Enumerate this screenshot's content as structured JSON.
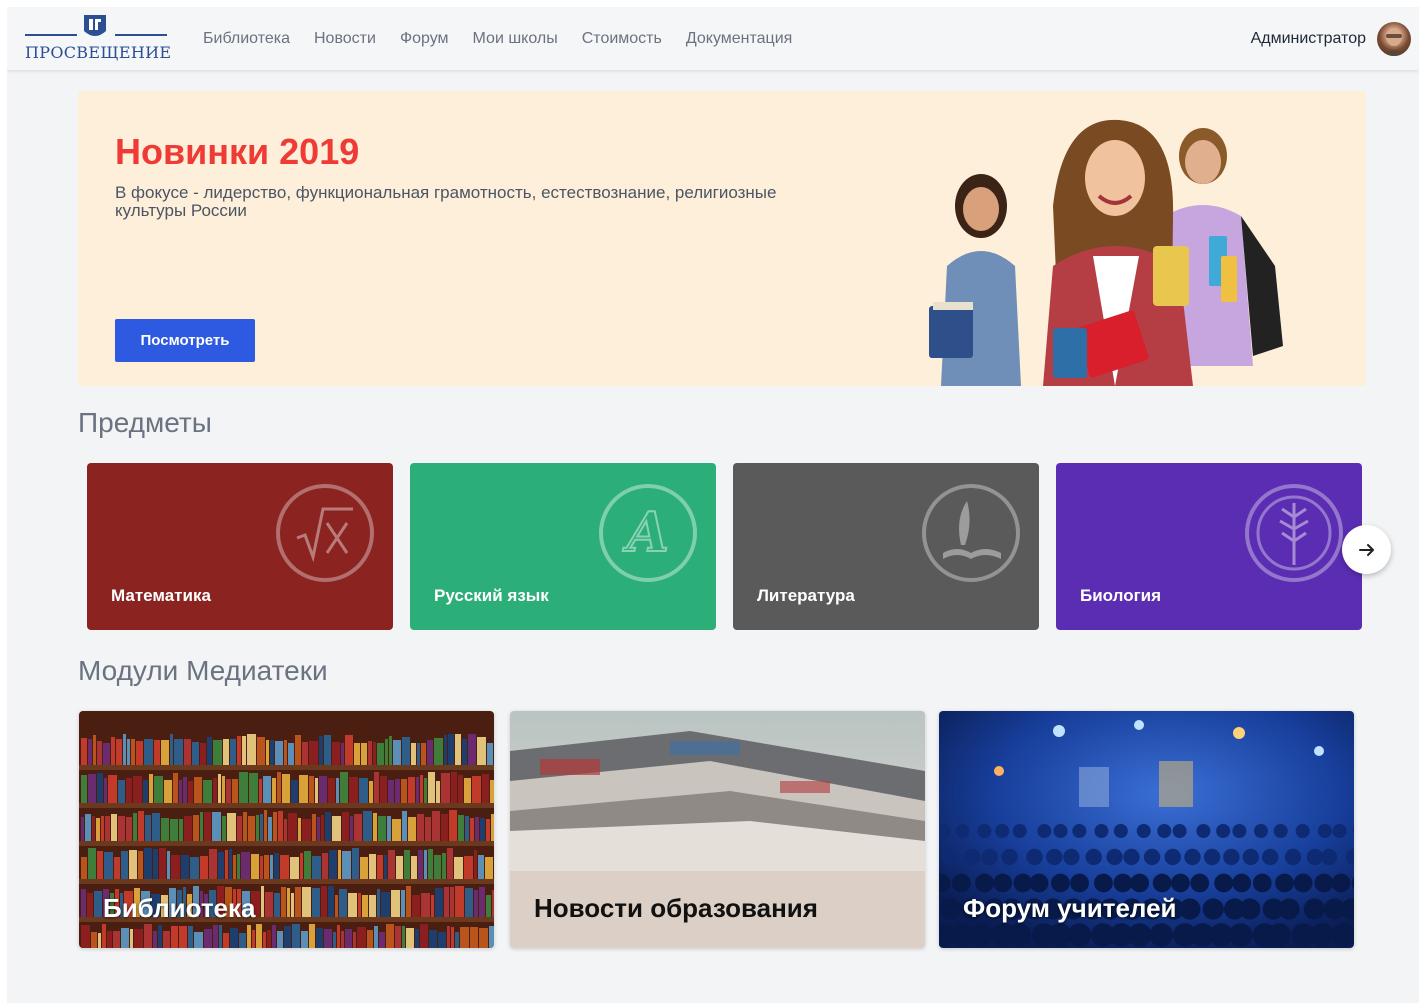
{
  "header": {
    "logo_text": "ПРОСВЕЩЕНИЕ",
    "nav": [
      "Библиотека",
      "Новости",
      "Форум",
      "Мои школы",
      "Стоимость",
      "Документация"
    ],
    "user_name": "Администратор"
  },
  "hero": {
    "title": "Новинки 2019",
    "subtitle": "В фокусе - лидерство, функциональная грамотность, естествознание, религиозные культуры России",
    "button": "Посмотреть"
  },
  "subjects": {
    "title": "Предметы",
    "items": [
      {
        "label": "Математика",
        "color": "#8b2321",
        "icon": "square-root-x-icon"
      },
      {
        "label": "Русский язык",
        "color": "#2bae78",
        "icon": "letter-a-icon"
      },
      {
        "label": "Литература",
        "color": "#5a5a5a",
        "icon": "quill-book-icon"
      },
      {
        "label": "Биология",
        "color": "#5b2db3",
        "icon": "leaf-icon"
      }
    ]
  },
  "modules": {
    "title": "Модули Медиатеки",
    "items": [
      {
        "label": "Библиотека",
        "icon": "bookshelf-image"
      },
      {
        "label": "Новости образования",
        "icon": "newspapers-image"
      },
      {
        "label": "Форум учителей",
        "icon": "conference-image"
      }
    ]
  },
  "colors": {
    "accent": "#2d5ae0",
    "hero_title": "#ef3b36",
    "hero_bg": "#fdefd9",
    "logo": "#2c4f94"
  }
}
